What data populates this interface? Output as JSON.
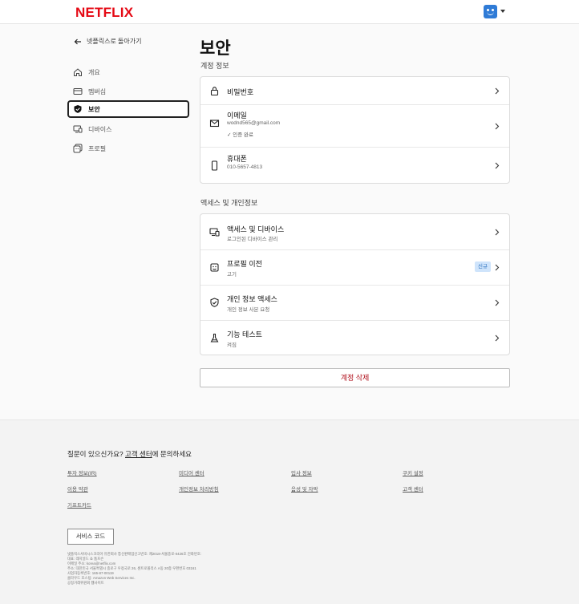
{
  "header": {
    "logo": "NETFLIX"
  },
  "sidebar": {
    "back_label": "넷플릭스로 돌아가기",
    "items": [
      {
        "label": "개요",
        "icon": "home-icon"
      },
      {
        "label": "멤버십",
        "icon": "card-icon"
      },
      {
        "label": "보안",
        "icon": "shield-icon",
        "active": true
      },
      {
        "label": "디바이스",
        "icon": "devices-icon"
      },
      {
        "label": "프로필",
        "icon": "profiles-icon"
      }
    ]
  },
  "page": {
    "title": "보안",
    "account_section": "계정 정보",
    "access_section": "액세스 및 개인정보",
    "delete_label": "계정 삭제"
  },
  "account_rows": [
    {
      "title": "비밀번호",
      "icon": "lock-icon"
    },
    {
      "title": "이메일",
      "sub": "wodnd565@gmail.com",
      "verified": "인증 완료",
      "icon": "mail-icon"
    },
    {
      "title": "휴대폰",
      "sub": "010-5657-4813",
      "icon": "phone-icon"
    }
  ],
  "access_rows": [
    {
      "title": "액세스 및 디바이스",
      "sub": "로그인된 디바이스 관리",
      "icon": "devices-icon"
    },
    {
      "title": "프로필 이전",
      "sub": "고기",
      "badge": "신규",
      "icon": "profile-transfer-icon"
    },
    {
      "title": "개인 정보 액세스",
      "sub": "개인 정보 사본 요청",
      "icon": "shield-check-icon"
    },
    {
      "title": "기능 테스트",
      "sub": "켜짐",
      "icon": "flask-icon"
    }
  ],
  "footer": {
    "question_prefix": "질문이 있으신가요? ",
    "question_link": "고객 센터",
    "question_suffix": "에 문의하세요",
    "links": [
      "투자 정보(IR)",
      "미디어 센터",
      "입사 정보",
      "쿠키 설정",
      "이용 약관",
      "개인정보 처리방침",
      "음성 및 자막",
      "고객 센터",
      "기프트카드"
    ],
    "service_code": "서비스 코드",
    "legal": [
      "넷플릭스서비시스코리아 유한회사 통신판매업신고번호: 제2018-서울종로-0426호 전화번호:",
      "대표: 레지널드 쇼 톰프슨",
      "이메일 주소: korea@netflix.com",
      "주소: 대한민국 서울특별시 종로구 우정국로 26, 센트로폴리스 A동 20층 우편번호 03161",
      "사업자등록번호: 165-87-00119",
      "클라우드 호스팅: Amazon Web Services Inc.",
      "공정거래위원회 웹사이트"
    ]
  }
}
